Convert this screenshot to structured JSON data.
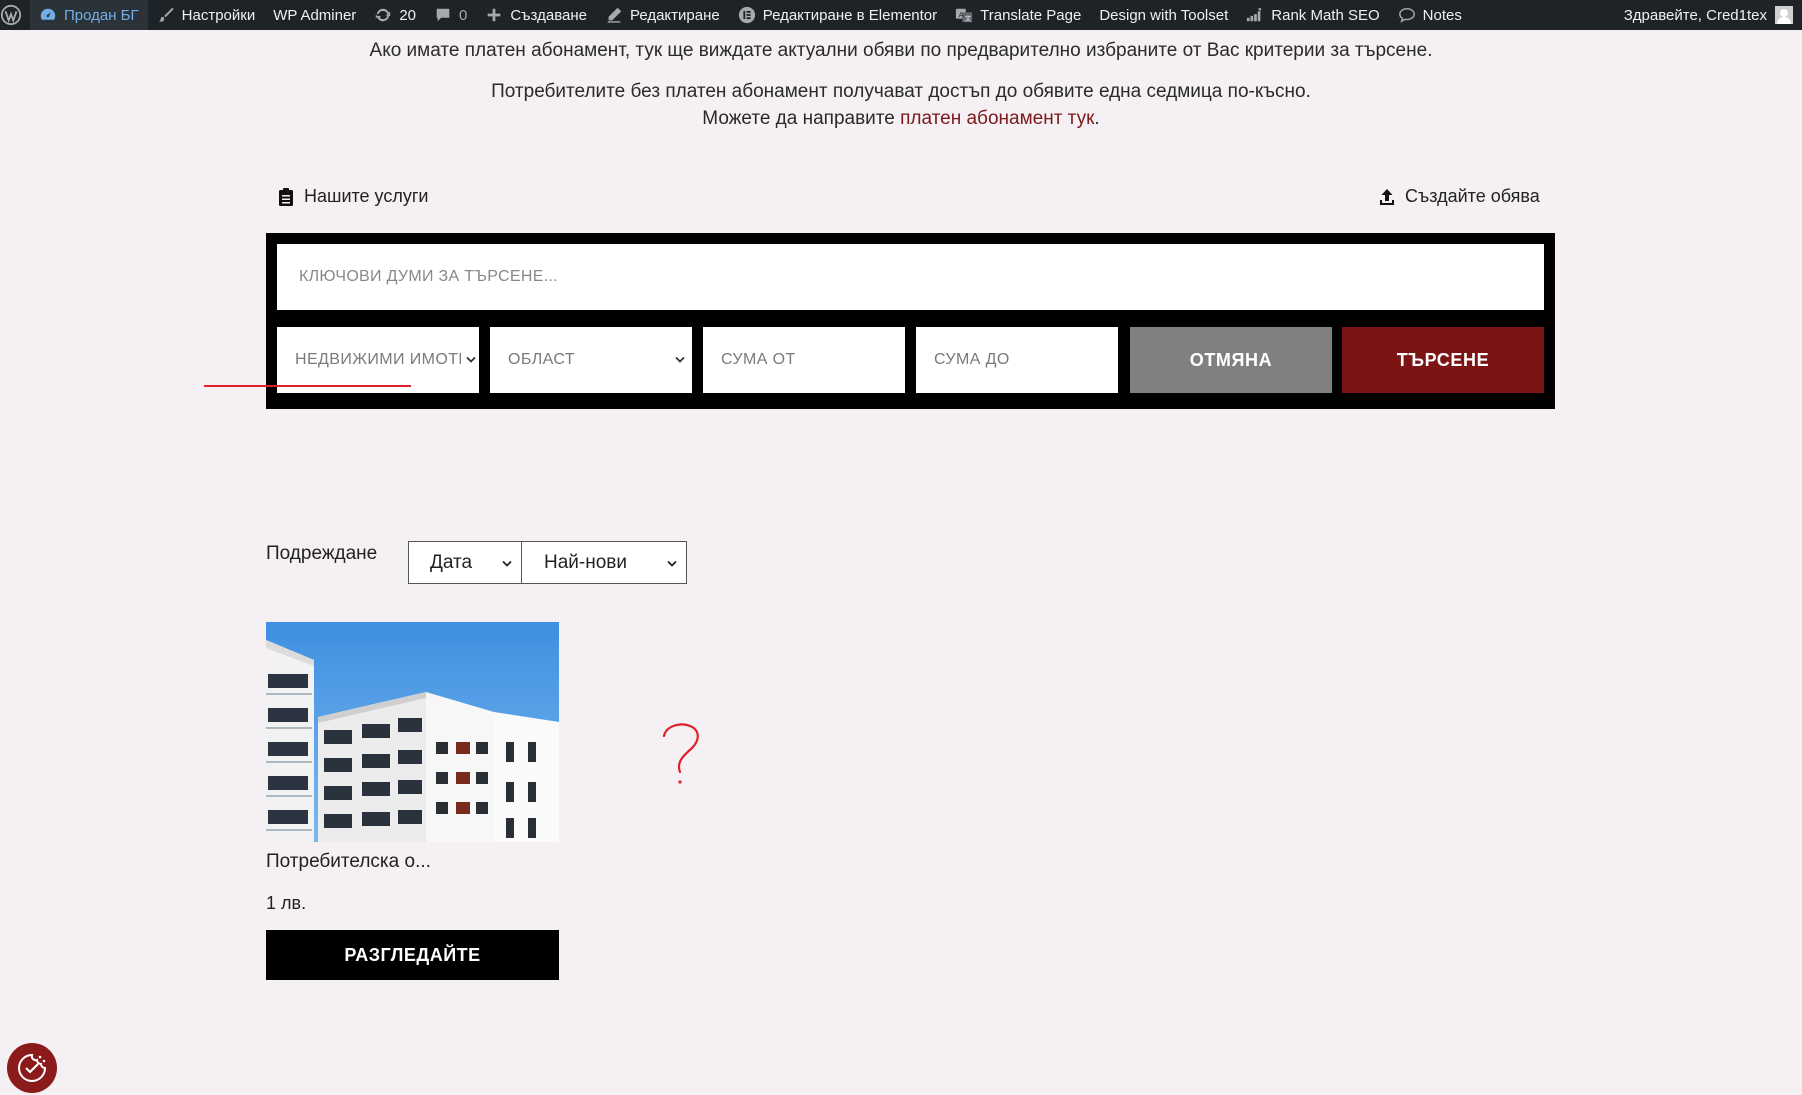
{
  "adminbar": {
    "site_name": "Продан БГ",
    "settings": "Настройки",
    "wp_adminer": "WP Adminer",
    "updates_count": "20",
    "comments_count": "0",
    "create": "Създаване",
    "edit": "Редактиране",
    "edit_elementor": "Редактиране в Elementor",
    "translate": "Translate Page",
    "toolset": "Design with Toolset",
    "rank_math": "Rank Math SEO",
    "notes": "Notes",
    "greeting": "Здравейте, Cred1tex"
  },
  "intro": {
    "line1": "Ако имате платен абонамент, тук ще виждате актуални обяви по предварително избраните от Вас критерии за търсене.",
    "line2": "Потребителите без платен абонамент получават достъп до обявите една седмица по-късно.",
    "line3_prefix": "Можете да направите ",
    "line3_link": "платен абонамент тук",
    "line3_suffix": "."
  },
  "links": {
    "services": "Нашите услуги",
    "create_ad": "Създайте обява"
  },
  "search": {
    "keywords_placeholder": "КЛЮЧОВИ ДУМИ ЗА ТЪРСЕНЕ...",
    "category": "НЕДВИЖИМИ ИМОТИ",
    "region": "ОБЛАСТ",
    "amount_from": "СУМА ОТ",
    "amount_to": "СУМА ДО",
    "cancel": "ОТМЯНА",
    "submit": "ТЪРСЕНЕ"
  },
  "sort": {
    "label": "Подреждане",
    "field": "Дата",
    "order": "Най-нови"
  },
  "listing": {
    "title": "Потребителска о...",
    "price": "1 лв.",
    "view_button": "РАЗГЛЕДАЙТЕ"
  },
  "colors": {
    "accent_red": "#7d1414",
    "cancel_gray": "#808080",
    "adminbar": "#1d2327",
    "background": "#f4f0f4"
  }
}
